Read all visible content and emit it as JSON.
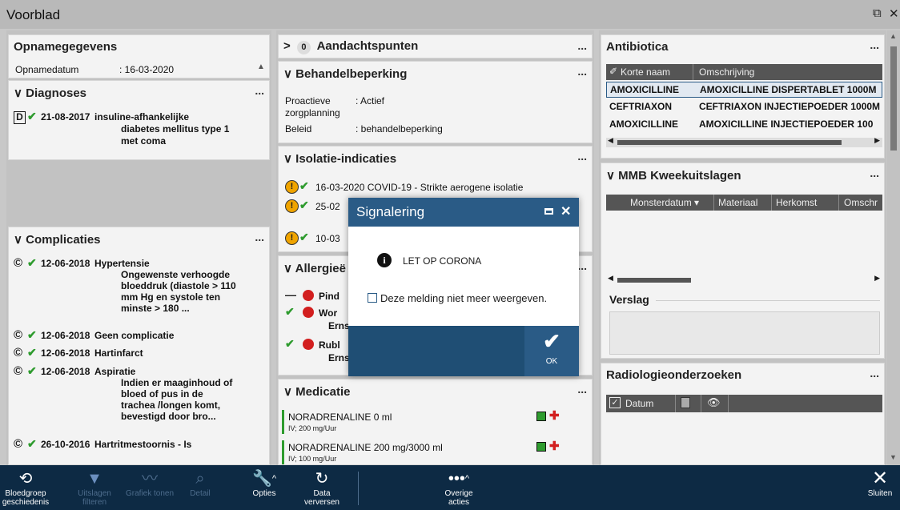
{
  "window": {
    "title": "Voorblad",
    "restore_icon": "restore-icon",
    "close_icon": "close-icon"
  },
  "opname": {
    "title": "Opnamegegevens",
    "label": "Opnamedatum",
    "value": ": 16-03-2020"
  },
  "diagnoses": {
    "title": "Diagnoses",
    "more": "...",
    "items": [
      {
        "badge": "D",
        "date": "21-08-2017",
        "text1": "insuline-afhankelijke",
        "text2": "diabetes mellitus type 1",
        "text3": "met coma"
      }
    ]
  },
  "complicaties": {
    "title": "Complicaties",
    "more": "...",
    "items": [
      {
        "date": "12-06-2018",
        "lines": [
          "Hypertensie",
          "Ongewenste verhoogde",
          "bloeddruk (diastole > 110",
          "mm Hg en systole ten",
          "minste > 180 ..."
        ]
      },
      {
        "date": "12-06-2018",
        "lines": [
          "Geen complicatie"
        ]
      },
      {
        "date": "12-06-2018",
        "lines": [
          "Hartinfarct"
        ]
      },
      {
        "date": "12-06-2018",
        "lines": [
          "Aspiratie",
          "Indien er maaginhoud of",
          "bloed of pus in de",
          "trachea /longen komt,",
          "bevestigd door bro..."
        ]
      },
      {
        "date": "26-10-2016",
        "lines": [
          "Hartritmestoornis   - Is"
        ]
      }
    ]
  },
  "aandacht": {
    "chevron": ">",
    "count": "0",
    "title": "Aandachtspunten",
    "more": "..."
  },
  "behandel": {
    "title": "Behandelbeperking",
    "more": "...",
    "row1_label": "Proactieve",
    "row1_value": ": Actief",
    "row1_label2": "zorgplanning",
    "row2_label": "Beleid",
    "row2_value": ": behandelbeperking"
  },
  "isolatie": {
    "title": "Isolatie-indicaties",
    "more": "...",
    "items": [
      {
        "text": "16-03-2020 COVID-19 - Strikte aerogene isolatie"
      },
      {
        "text": "25-02"
      },
      {
        "text": "10-03"
      }
    ]
  },
  "allergie": {
    "title": "Allergieë",
    "more": "...",
    "items": [
      {
        "prefix": "—",
        "text": "Pind",
        "sub": ""
      },
      {
        "prefix": "✔",
        "text": "Wor",
        "sub": "Erns"
      },
      {
        "prefix": "✔",
        "text": "Rubl",
        "sub": "Erns"
      }
    ]
  },
  "medicatie": {
    "title": "Medicatie",
    "more": "...",
    "items": [
      {
        "name": "NORADRENALINE 0 ml",
        "sub": "IV; 200 mg/Uur"
      },
      {
        "name": "NORADRENALINE 200 mg/3000 ml",
        "sub": "IV; 100 mg/Uur"
      }
    ]
  },
  "antibiotica": {
    "title": "Antibiotica",
    "more": "...",
    "headers": [
      "Korte naam",
      "Omschrijving"
    ],
    "rows": [
      [
        "AMOXICILLINE",
        "AMOXICILLINE DISPERTABLET 1000M"
      ],
      [
        "CEFTRIAXON",
        "CEFTRIAXON INJECTIEPOEDER 1000M"
      ],
      [
        "AMOXICILLINE",
        "AMOXICILLINE INJECTIEPOEDER 100"
      ]
    ]
  },
  "mmb": {
    "title": "MMB Kweekuitslagen",
    "more": "...",
    "headers": [
      "Monsterdatum ▾",
      "Materiaal",
      "Herkomst",
      "Omschr"
    ],
    "verslag_label": "Verslag"
  },
  "radiologie": {
    "title": "Radiologieonderzoeken",
    "more": "...",
    "headers": [
      "Datum"
    ]
  },
  "dialog": {
    "title": "Signalering",
    "message": "LET OP CORONA",
    "checkbox_label": "Deze melding niet meer weergeven.",
    "ok_label": "OK"
  },
  "bottombar": {
    "items": [
      {
        "label1": "Bloedgroep",
        "label2": "geschiedenis",
        "icon": "blood-history-icon",
        "dim": false
      },
      {
        "label1": "Uitslagen",
        "label2": "filteren",
        "icon": "filter-icon",
        "dim": true
      },
      {
        "label1": "Grafiek tonen",
        "label2": "",
        "icon": "graph-icon",
        "dim": true
      },
      {
        "label1": "Detail",
        "label2": "",
        "icon": "search-icon",
        "dim": true
      },
      {
        "label1": "Opties",
        "label2": "",
        "icon": "wrench-icon",
        "dim": false
      },
      {
        "label1": "Data",
        "label2": "verversen",
        "icon": "refresh-icon",
        "dim": false
      },
      {
        "label1": "Overige",
        "label2": "acties",
        "icon": "more-icon",
        "dim": false
      },
      {
        "label1": "Sluiten",
        "label2": "",
        "icon": "close-icon",
        "dim": false
      }
    ]
  }
}
